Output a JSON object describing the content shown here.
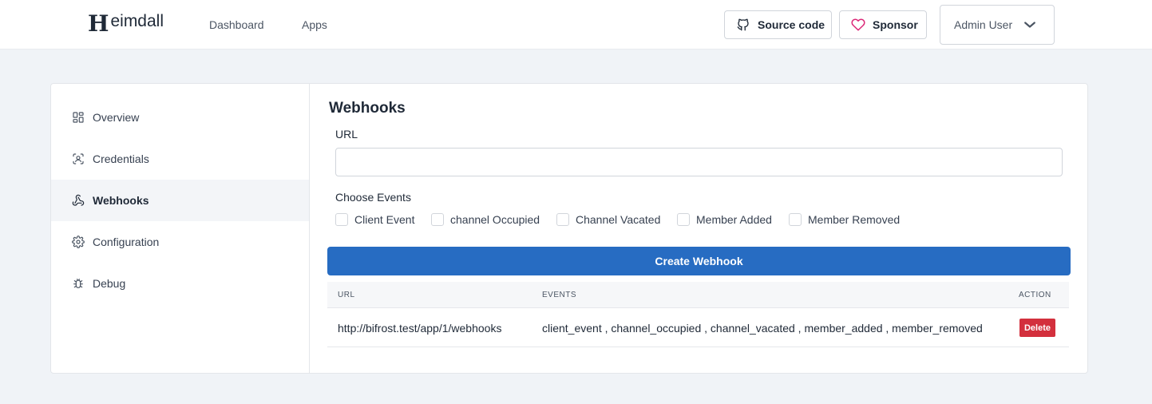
{
  "header": {
    "logo_letter": "H",
    "logo_text": "eimdall",
    "nav": {
      "dashboard": "Dashboard",
      "apps": "Apps"
    },
    "source_code_label": "Source code",
    "sponsor_label": "Sponsor",
    "user_label": "Admin User"
  },
  "sidebar": {
    "items": [
      {
        "label": "Overview",
        "icon": "grid-icon"
      },
      {
        "label": "Credentials",
        "icon": "id-badge-icon"
      },
      {
        "label": "Webhooks",
        "icon": "webhook-icon",
        "active": true
      },
      {
        "label": "Configuration",
        "icon": "gear-icon"
      },
      {
        "label": "Debug",
        "icon": "bug-icon"
      }
    ]
  },
  "main": {
    "title": "Webhooks",
    "url_label": "URL",
    "url_value": "",
    "events_label": "Choose Events",
    "events": [
      {
        "label": "Client Event",
        "checked": false
      },
      {
        "label": "channel Occupied",
        "checked": false
      },
      {
        "label": "Channel Vacated",
        "checked": false
      },
      {
        "label": "Member Added",
        "checked": false
      },
      {
        "label": "Member Removed",
        "checked": false
      }
    ],
    "create_button": "Create Webhook",
    "table": {
      "headers": {
        "url": "URL",
        "events": "EVENTS",
        "action": "ACTION"
      },
      "rows": [
        {
          "url": "http://bifrost.test/app/1/webhooks",
          "events": "client_event , channel_occupied , channel_vacated , member_added , member_removed",
          "action": "Delete"
        }
      ]
    }
  },
  "colors": {
    "primary": "#276cc2",
    "danger": "#d3303d",
    "sponsor_heart": "#db2777",
    "background": "#f0f3f7"
  }
}
